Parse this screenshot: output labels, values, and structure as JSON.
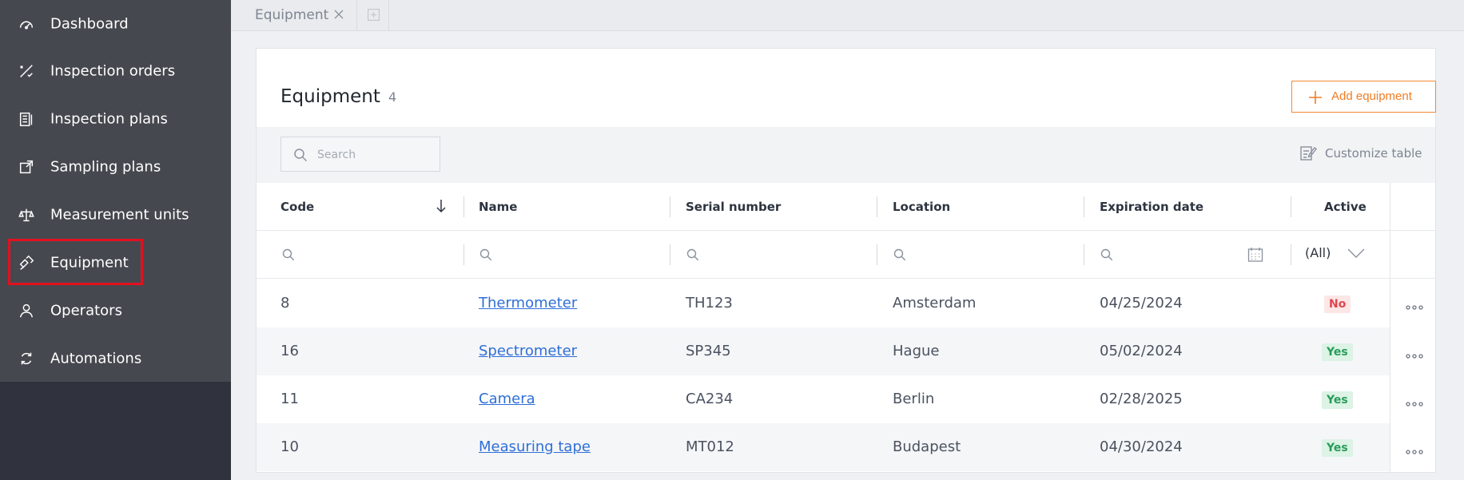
{
  "sidebar": {
    "items": [
      {
        "label": "Dashboard",
        "icon": "dashboard-icon"
      },
      {
        "label": "Inspection orders",
        "icon": "inspection-orders-icon"
      },
      {
        "label": "Inspection plans",
        "icon": "inspection-plans-icon"
      },
      {
        "label": "Sampling plans",
        "icon": "sampling-plans-icon"
      },
      {
        "label": "Measurement units",
        "icon": "scale-icon"
      },
      {
        "label": "Equipment",
        "icon": "equipment-icon"
      },
      {
        "label": "Operators",
        "icon": "operator-icon"
      },
      {
        "label": "Automations",
        "icon": "refresh-icon"
      }
    ],
    "selected": "Equipment"
  },
  "tabs": {
    "items": [
      {
        "label": "Equipment"
      }
    ]
  },
  "page": {
    "title": "Equipment",
    "count": "4",
    "add_button_label": "Add equipment",
    "search_placeholder": "Search",
    "customize_label": "Customize table"
  },
  "table": {
    "columns": [
      "Code",
      "Name",
      "Serial number",
      "Location",
      "Expiration date",
      "Active"
    ],
    "active_filter": "(All)",
    "rows": [
      {
        "code": "8",
        "name": "Thermometer",
        "serial": "TH123",
        "location": "Amsterdam",
        "expiration": "04/25/2024",
        "active": "No"
      },
      {
        "code": "16",
        "name": "Spectrometer",
        "serial": "SP345",
        "location": "Hague",
        "expiration": "05/02/2024",
        "active": "Yes"
      },
      {
        "code": "11",
        "name": "Camera",
        "serial": "CA234",
        "location": "Berlin",
        "expiration": "02/28/2025",
        "active": "Yes"
      },
      {
        "code": "10",
        "name": "Measuring tape",
        "serial": "MT012",
        "location": "Budapest",
        "expiration": "04/30/2024",
        "active": "Yes"
      }
    ]
  },
  "colors": {
    "accent": "#f07c21",
    "link": "#2f6fd6",
    "sidebar_bg": "#46484f",
    "highlight": "#e3101e",
    "yes_badge": "#2a9c5b",
    "no_badge": "#e0464e"
  }
}
